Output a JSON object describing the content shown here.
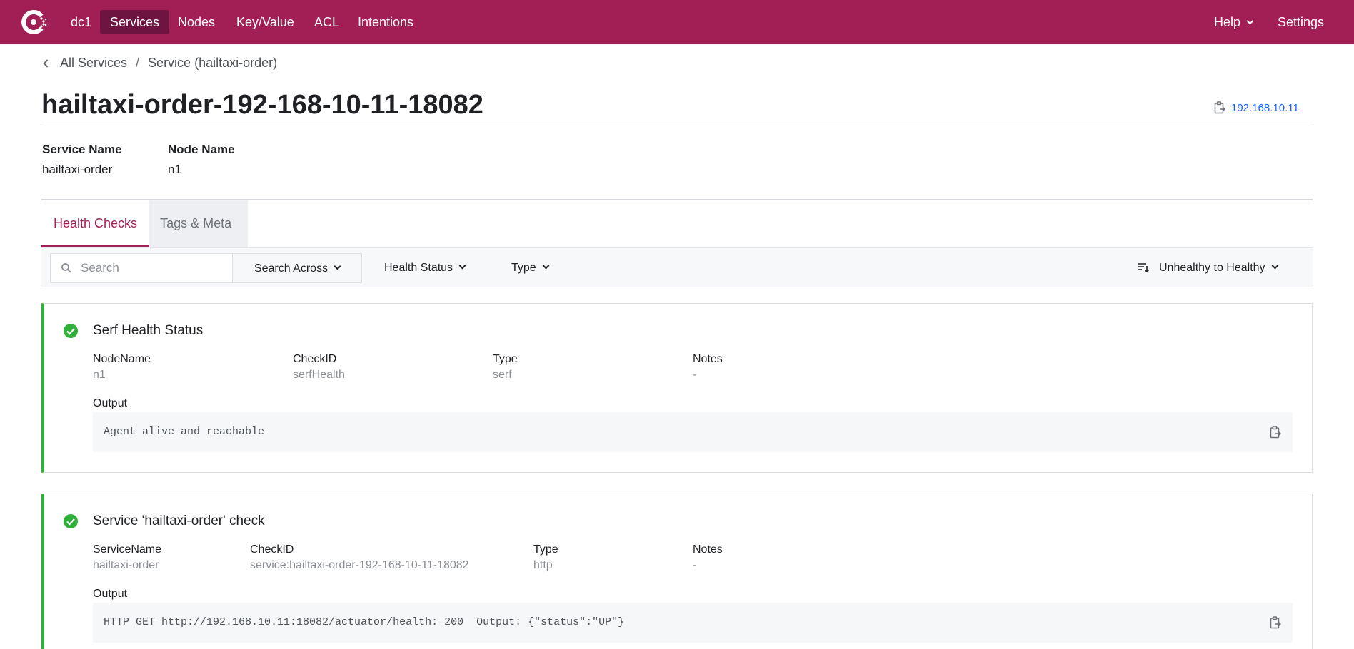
{
  "colors": {
    "brand": "#a21f56",
    "brand_active": "#6d1540",
    "passing": "#2eb039",
    "link": "#1563ff"
  },
  "nav": {
    "logo_icon": "consul-logo-icon",
    "items": [
      {
        "label": "dc1"
      },
      {
        "label": "Services"
      },
      {
        "label": "Nodes"
      },
      {
        "label": "Key/Value"
      },
      {
        "label": "ACL"
      },
      {
        "label": "Intentions"
      }
    ],
    "active": "Services",
    "help": "Help",
    "settings": "Settings"
  },
  "breadcrumb": {
    "back": "All Services",
    "separator": "/",
    "current": "Service (hailtaxi-order)"
  },
  "title": "hailtaxi-order-192-168-10-11-18082",
  "address": "192.168.10.11",
  "meta": {
    "service_name_label": "Service Name",
    "service_name": "hailtaxi-order",
    "node_name_label": "Node Name",
    "node_name": "n1"
  },
  "tabs": [
    {
      "label": "Health Checks",
      "active": true
    },
    {
      "label": "Tags & Meta",
      "active": false
    }
  ],
  "filters": {
    "search_placeholder": "Search",
    "search_value": "",
    "search_across": "Search Across",
    "health_status": "Health Status",
    "type": "Type",
    "sort": "Unhealthy to Healthy"
  },
  "checks": [
    {
      "status": "passing",
      "title": "Serf Health Status",
      "fields": [
        {
          "label": "NodeName",
          "value": "n1"
        },
        {
          "label": "CheckID",
          "value": "serfHealth"
        },
        {
          "label": "Type",
          "value": "serf"
        },
        {
          "label": "Notes",
          "value": "-"
        }
      ],
      "output_label": "Output",
      "output": "Agent alive and reachable"
    },
    {
      "status": "passing",
      "title": "Service 'hailtaxi-order' check",
      "fields": [
        {
          "label": "ServiceName",
          "value": "hailtaxi-order"
        },
        {
          "label": "CheckID",
          "value": "service:hailtaxi-order-192-168-10-11-18082"
        },
        {
          "label": "Type",
          "value": "http"
        },
        {
          "label": "Notes",
          "value": "-"
        }
      ],
      "output_label": "Output",
      "output": "HTTP GET http://192.168.10.11:18082/actuator/health: 200  Output: {\"status\":\"UP\"}"
    }
  ]
}
